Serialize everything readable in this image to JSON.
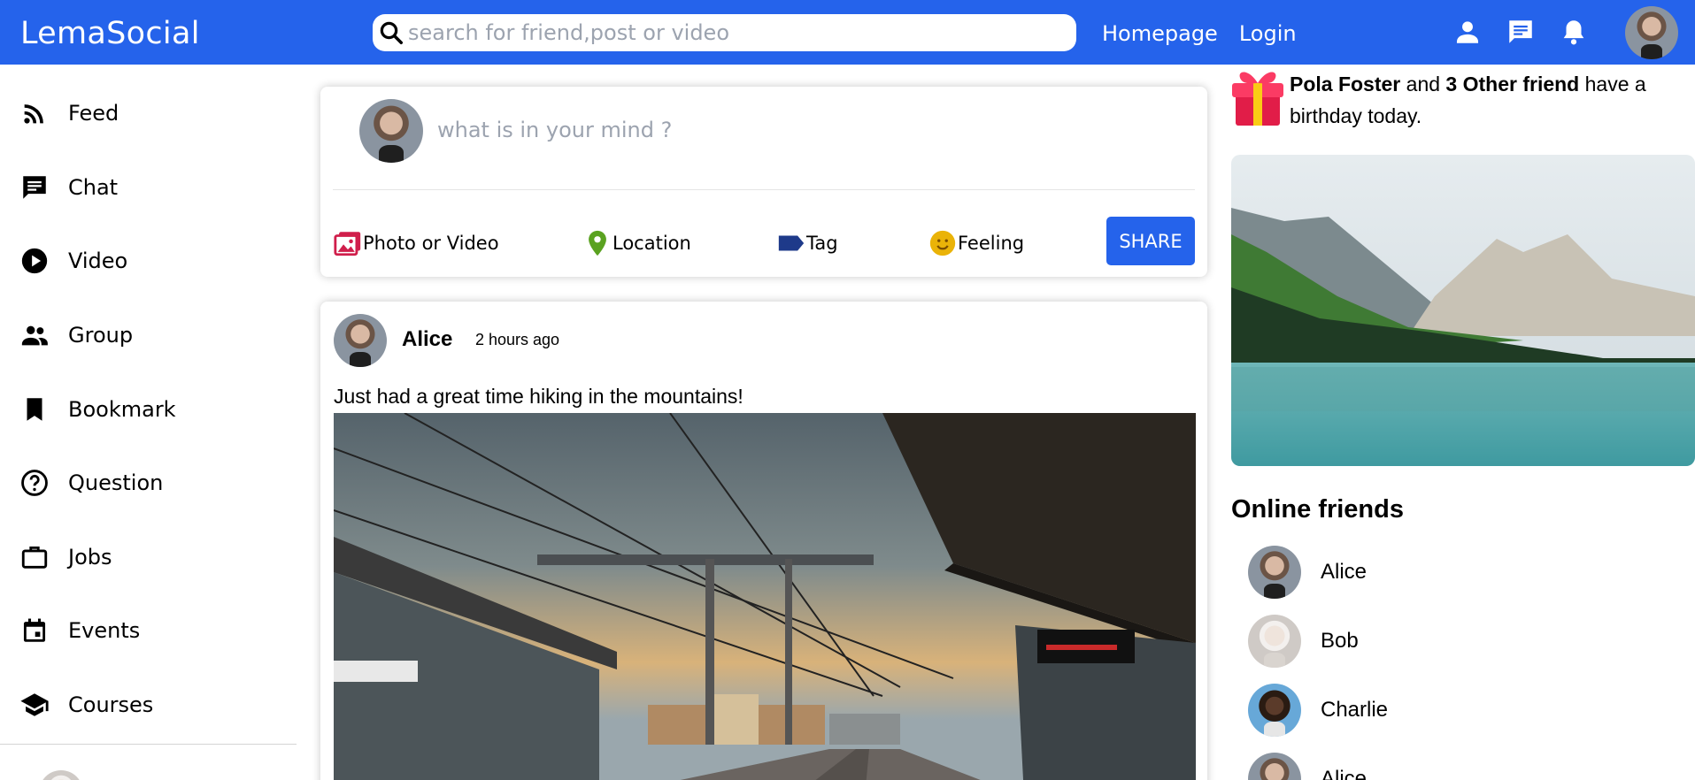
{
  "header": {
    "logo": "LemaSocial",
    "search_placeholder": "search for friend,post or video",
    "nav": [
      "Homepage",
      "Login"
    ],
    "icons": [
      "person-icon",
      "chat-icon",
      "bell-icon"
    ],
    "accent_color": "#2563eb"
  },
  "sidebar": {
    "items": [
      {
        "label": "Feed",
        "icon": "rss-feed-icon"
      },
      {
        "label": "Chat",
        "icon": "chat-icon"
      },
      {
        "label": "Video",
        "icon": "play-circle-icon"
      },
      {
        "label": "Group",
        "icon": "group-icon"
      },
      {
        "label": "Bookmark",
        "icon": "bookmark-icon"
      },
      {
        "label": "Question",
        "icon": "help-circle-icon"
      },
      {
        "label": "Jobs",
        "icon": "briefcase-icon"
      },
      {
        "label": "Events",
        "icon": "calendar-icon"
      },
      {
        "label": "Courses",
        "icon": "school-icon"
      }
    ]
  },
  "share": {
    "placeholder": "what is in your mind ?",
    "options": [
      {
        "label": "Photo or Video",
        "icon": "photo-icon",
        "color": "#d01e4b"
      },
      {
        "label": "Location",
        "icon": "location-pin-icon",
        "color": "#5aa220"
      },
      {
        "label": "Tag",
        "icon": "tag-icon",
        "color": "#1e3a8a"
      },
      {
        "label": "Feeling",
        "icon": "smiley-icon",
        "color": "#eab308"
      }
    ],
    "button": "SHARE"
  },
  "post": {
    "author": "Alice",
    "time": "2 hours ago",
    "text": "Just had a great time hiking in the mountains!"
  },
  "rightbar": {
    "birthday_name": "Pola Foster",
    "birthday_and": " and ",
    "birthday_others": "3 Other friend",
    "birthday_rest": " have a birthday today.",
    "online_title": "Online friends",
    "friends": [
      {
        "name": "Alice"
      },
      {
        "name": "Bob"
      },
      {
        "name": "Charlie"
      },
      {
        "name": "Alice"
      }
    ]
  }
}
